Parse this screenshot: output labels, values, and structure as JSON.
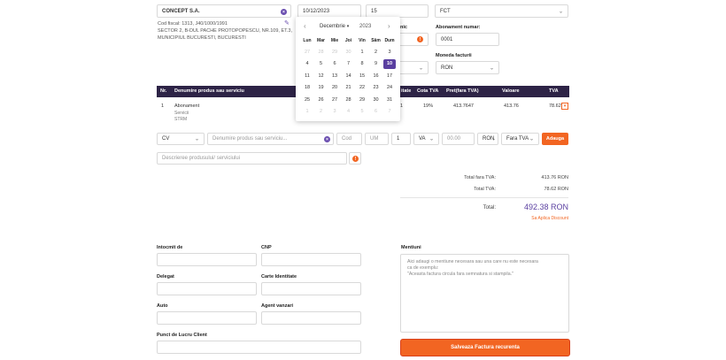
{
  "client": {
    "name_value": "CONCEPT S.A.",
    "cod_fiscal": "Cod fiscal: 1313, J40/1000/1991",
    "address_line1": "SECTOR 2, B-DUL PACHE PROTOPOPESCU, NR.109, ET.3,",
    "address_line2": "MUNICIPIUL BUCURESTI, BUCURESTI"
  },
  "invoice": {
    "date_value": "10/12/2023",
    "days_value": "15",
    "serie_value": "FCT",
    "abonament_label": "Abonament numar:",
    "abonament_value": "0001",
    "moneda_label": "Moneda facturii",
    "moneda_value": "RON",
    "partial_label": "nic"
  },
  "calendar": {
    "month": "Decembrie",
    "year": "2023",
    "weekdays": [
      "Lun",
      "Mar",
      "Mie",
      "Joi",
      "Vin",
      "Sâm",
      "Dum"
    ],
    "weeks": [
      [
        "27",
        "28",
        "29",
        "30",
        "1",
        "2",
        "3"
      ],
      [
        "4",
        "5",
        "6",
        "7",
        "8",
        "9",
        "10"
      ],
      [
        "11",
        "12",
        "13",
        "14",
        "15",
        "16",
        "17"
      ],
      [
        "18",
        "19",
        "20",
        "21",
        "22",
        "23",
        "24"
      ],
      [
        "25",
        "26",
        "27",
        "28",
        "29",
        "30",
        "31"
      ],
      [
        "1",
        "2",
        "3",
        "4",
        "5",
        "6",
        "7"
      ]
    ],
    "selected": "10"
  },
  "table": {
    "headers": {
      "nr": "Nr.",
      "denumire": "Denumire produs sau serviciu",
      "cantitate": "itate",
      "cota_tva": "Cota TVA",
      "pret": "Pret(fara TVA)",
      "valoare": "Valoare",
      "tva": "TVA"
    },
    "row": {
      "nr": "1",
      "name": "Abonament",
      "sub1": "Servicii",
      "sub2": "STRM",
      "qty": "1",
      "cota": "19%",
      "pret": "413.7647",
      "valoare": "413.76",
      "tva": "78.62"
    }
  },
  "add_row": {
    "type_value": "CV",
    "product_placeholder": "Denumire produs sau serviciu...",
    "cod_placeholder": "Cod",
    "um_placeholder": "UM",
    "qty_value": "1",
    "tva_value": "VA",
    "price_placeholder": "00.00",
    "currency_value": "RON",
    "tva_mode_value": "Fara TVA",
    "add_label": "Adauga",
    "desc_placeholder": "Descrieree produsului/ serviciului"
  },
  "totals": {
    "fara_tva_label": "Total fara TVA:",
    "fara_tva_value": "413.76 RON",
    "tva_label": "Total TVA:",
    "tva_value": "78.62 RON",
    "total_label": "Total:",
    "total_value": "492.38 RON",
    "discount_link": "Sa Aplica Discount"
  },
  "footer": {
    "intocmit_label": "Intocmit de",
    "cnp_label": "CNP",
    "delegat_label": "Delegat",
    "carte_label": "Carte Identitate",
    "auto_label": "Auto",
    "agent_label": "Agent vanzari",
    "punct_label": "Punct de Lucru Client",
    "mentiuni_label": "Mentiuni",
    "mentiuni_placeholder_1": "Aici adaugi o mentiune necesara sau una care nu este necesara",
    "mentiuni_placeholder_2": "ca de exemplu:",
    "mentiuni_placeholder_3": "\"Aceasta factura circula fara semnatura si stampila.\"",
    "save_label": "Salveaza Factura recurenta"
  },
  "colors": {
    "accent": "#f26522",
    "header": "#2d2346",
    "selected_day": "#5a3fa0",
    "total": "#5a3fa0"
  }
}
